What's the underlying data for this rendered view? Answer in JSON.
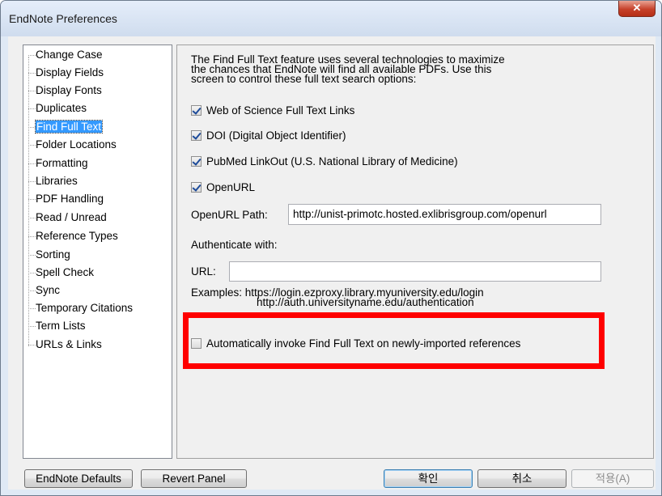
{
  "window": {
    "title": "EndNote Preferences",
    "close_glyph": "✕"
  },
  "sidebar": {
    "items": [
      {
        "label": "Change Case"
      },
      {
        "label": "Display Fields"
      },
      {
        "label": "Display Fonts"
      },
      {
        "label": "Duplicates"
      },
      {
        "label": "Find Full Text",
        "selected": true
      },
      {
        "label": "Folder Locations"
      },
      {
        "label": "Formatting"
      },
      {
        "label": "Libraries"
      },
      {
        "label": "PDF Handling"
      },
      {
        "label": "Read / Unread"
      },
      {
        "label": "Reference Types"
      },
      {
        "label": "Sorting"
      },
      {
        "label": "Spell Check"
      },
      {
        "label": "Sync"
      },
      {
        "label": "Temporary Citations"
      },
      {
        "label": "Term Lists"
      },
      {
        "label": "URLs & Links"
      }
    ]
  },
  "panel": {
    "description": [
      "The Find Full Text feature uses several technologies to maximize",
      "the chances that EndNote will find all available PDFs. Use this",
      "screen to control these full text search options:"
    ],
    "options": [
      {
        "label": "Web of Science Full Text Links",
        "checked": true
      },
      {
        "label": "DOI (Digital Object Identifier)",
        "checked": true
      },
      {
        "label": "PubMed LinkOut (U.S. National Library of Medicine)",
        "checked": true
      },
      {
        "label": "OpenURL",
        "checked": true
      }
    ],
    "openurl_path_label": "OpenURL Path:",
    "openurl_path_value": "http://unist-primotc.hosted.exlibrisgroup.com/openurl",
    "authenticate_label": "Authenticate with:",
    "url_label": "URL:",
    "url_value": "",
    "examples_label": "Examples:",
    "example_1": "https://login.ezproxy.library.myuniversity.edu/login",
    "example_2": "http://auth.universityname.edu/authentication",
    "auto_invoke_label": "Automatically invoke Find Full Text on newly-imported references",
    "auto_invoke_checked": false
  },
  "buttons": {
    "defaults": "EndNote Defaults",
    "revert": "Revert Panel",
    "ok": "확인",
    "cancel": "취소",
    "apply": "적용(A)"
  },
  "highlight_color": "#ff0000",
  "selection_color": "#3399ff"
}
